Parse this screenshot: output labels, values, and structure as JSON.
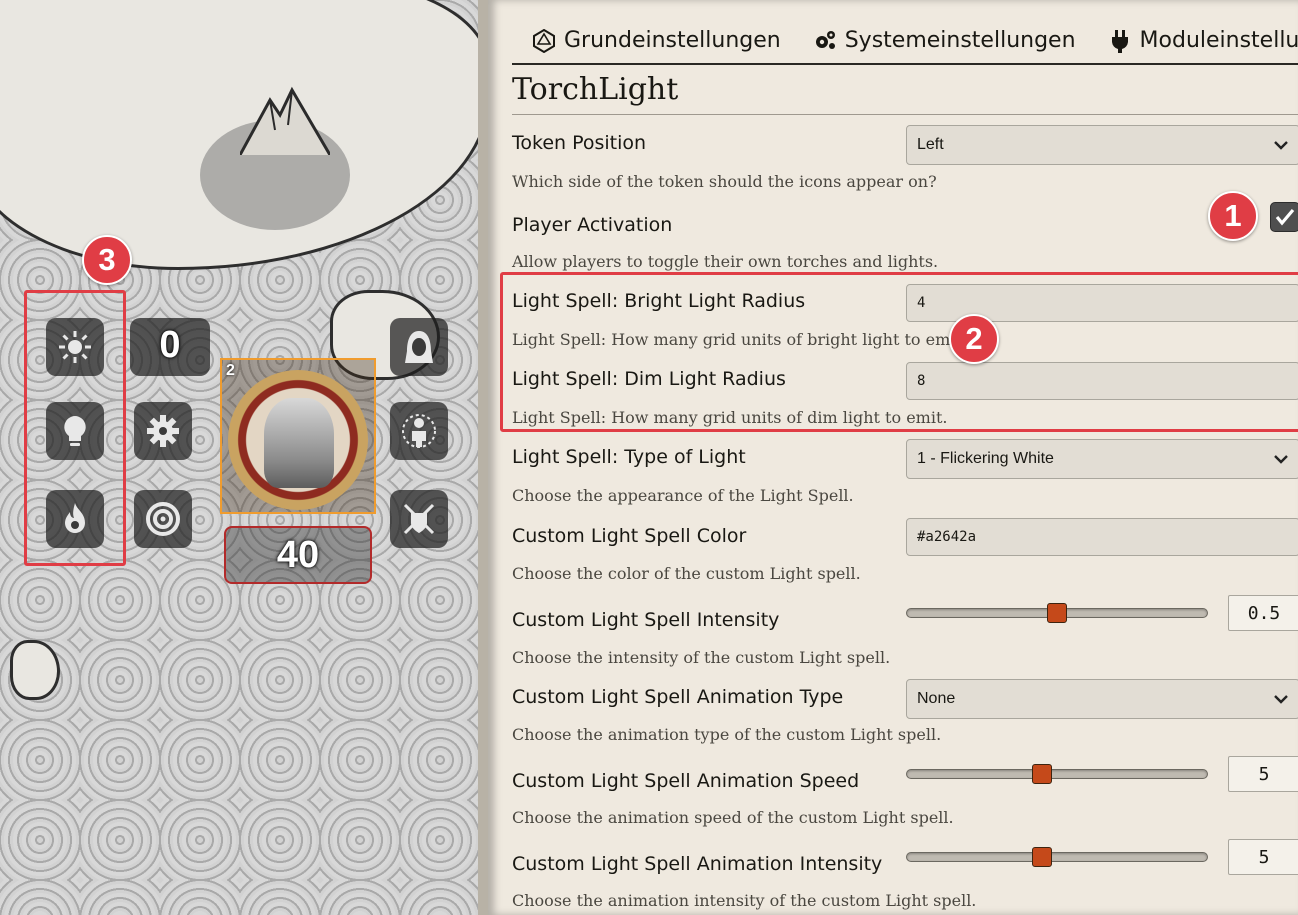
{
  "map": {
    "hud": {
      "elevation_value": "0",
      "hp_value": "40",
      "token_badge": "2"
    }
  },
  "annotations": {
    "badge1": "1",
    "badge2": "2",
    "badge3": "3",
    "accent_color": "#e03d45"
  },
  "tabs": [
    {
      "label": "Grundeinstellungen",
      "icon": "d20-icon"
    },
    {
      "label": "Systemeinstellungen",
      "icon": "gears-icon"
    },
    {
      "label": "Moduleinstellungen",
      "icon": "plug-icon"
    }
  ],
  "section_title": "TorchLight",
  "settings": {
    "token_position": {
      "label": "Token Position",
      "value": "Left",
      "hint": "Which side of the token should the icons appear on?"
    },
    "player_activation": {
      "label": "Player Activation",
      "checked": true,
      "hint": "Allow players to toggle their own torches and lights."
    },
    "bright_radius": {
      "label": "Light Spell: Bright Light Radius",
      "value": "4",
      "hint": "Light Spell: How many grid units of bright light to emit."
    },
    "dim_radius": {
      "label": "Light Spell: Dim Light Radius",
      "value": "8",
      "hint": "Light Spell: How many grid units of dim light to emit."
    },
    "type_of_light": {
      "label": "Light Spell: Type of Light",
      "value": "1 - Flickering White",
      "hint": "Choose the appearance of the Light Spell."
    },
    "custom_color": {
      "label": "Custom Light Spell Color",
      "value": "#a2642a",
      "hint": "Choose the color of the custom Light spell."
    },
    "custom_intensity": {
      "label": "Custom Light Spell Intensity",
      "value": "0.5",
      "fraction": 0.5,
      "hint": "Choose the intensity of the custom Light spell."
    },
    "anim_type": {
      "label": "Custom Light Spell Animation Type",
      "value": "None",
      "hint": "Choose the animation type of the custom Light spell."
    },
    "anim_speed": {
      "label": "Custom Light Spell Animation Speed",
      "value": "5",
      "fraction": 0.45,
      "hint": "Choose the animation speed of the custom Light spell."
    },
    "anim_intensity": {
      "label": "Custom Light Spell Animation Intensity",
      "value": "5",
      "fraction": 0.45,
      "hint": "Choose the animation intensity of the custom Light spell."
    }
  }
}
